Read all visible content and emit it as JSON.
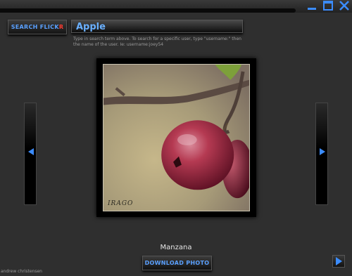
{
  "search": {
    "button_label_main": "SEARCH FLICK",
    "button_label_accent": "R",
    "query": "Apple",
    "hint": "Type in search term above. To search for a specific user, type \"username:\" then the name of the user. Ie: username:joey54"
  },
  "photo": {
    "title": "Manzana",
    "watermark": "IRAGO"
  },
  "actions": {
    "download_label": "DOWNLOAD PHOTO"
  },
  "credit": "andrew christensen",
  "colors": {
    "accent_blue": "#3b8cff",
    "accent_red": "#ff3b30"
  },
  "icons": {
    "window_controls": [
      "minimize-icon",
      "maximize-icon",
      "close-icon"
    ],
    "nav": [
      "arrow-left-icon",
      "arrow-right-icon",
      "play-icon"
    ]
  }
}
